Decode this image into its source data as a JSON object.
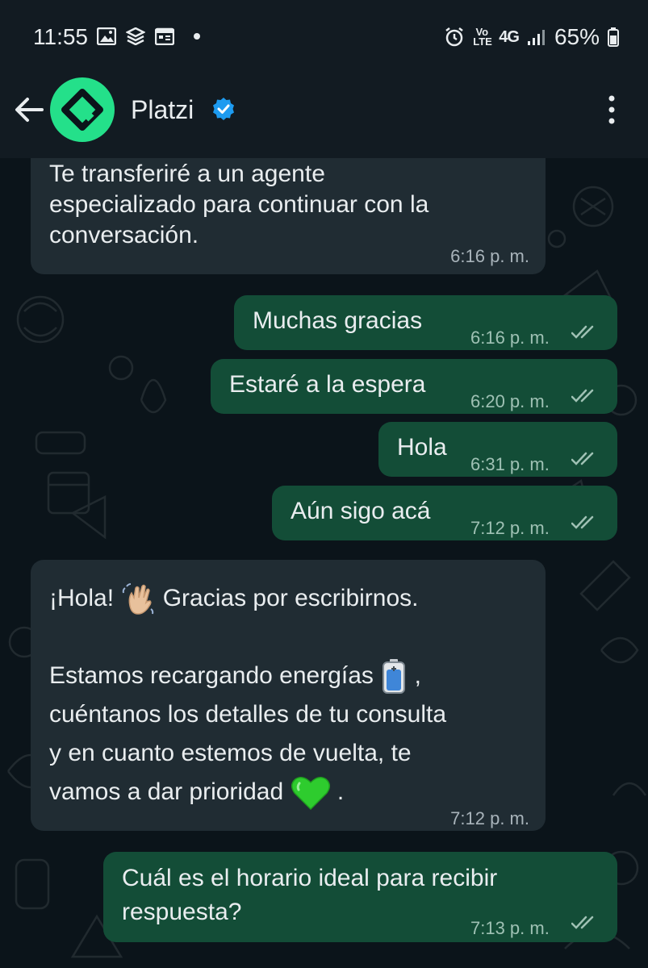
{
  "status_bar": {
    "time": "11:55",
    "network_volte": "Vo LTE",
    "network_type": "4G",
    "battery": "65%"
  },
  "header": {
    "contact_name": "Platzi",
    "verified": true
  },
  "messages": [
    {
      "direction": "in",
      "lines": [
        "Te transferiré a un agente",
        "especializado para continuar con la",
        "conversación."
      ],
      "time": "6:16 p. m."
    },
    {
      "direction": "out",
      "lines": [
        "Muchas gracias"
      ],
      "time": "6:16 p. m.",
      "status": "read"
    },
    {
      "direction": "out",
      "lines": [
        "Estaré a la espera"
      ],
      "time": "6:20 p. m.",
      "status": "read"
    },
    {
      "direction": "out",
      "lines": [
        "Hola"
      ],
      "time": "6:31 p. m.",
      "status": "read"
    },
    {
      "direction": "out",
      "lines": [
        "Aún sigo acá"
      ],
      "time": "7:12 p. m.",
      "status": "read"
    },
    {
      "direction": "in",
      "line1_a": "¡Hola!",
      "line1_b": "Gracias por escribirnos.",
      "line2": "Estamos recargando energías",
      "line2_end": ",",
      "line3": "cuéntanos los detalles de tu consulta",
      "line4": "y en cuanto estemos de vuelta, te",
      "line5": "vamos a dar prioridad",
      "line5_end": ".",
      "time": "7:12 p. m."
    },
    {
      "direction": "out",
      "lines": [
        "Cuál es el horario ideal para recibir",
        "respuesta?"
      ],
      "time": "7:13 p. m.",
      "status": "read"
    }
  ],
  "colors": {
    "incoming_bubble": "#202c33",
    "outgoing_bubble": "#134d37",
    "chat_background": "#0b141a",
    "brand_green": "#24e08a",
    "verified_blue": "#1d9bf0"
  }
}
